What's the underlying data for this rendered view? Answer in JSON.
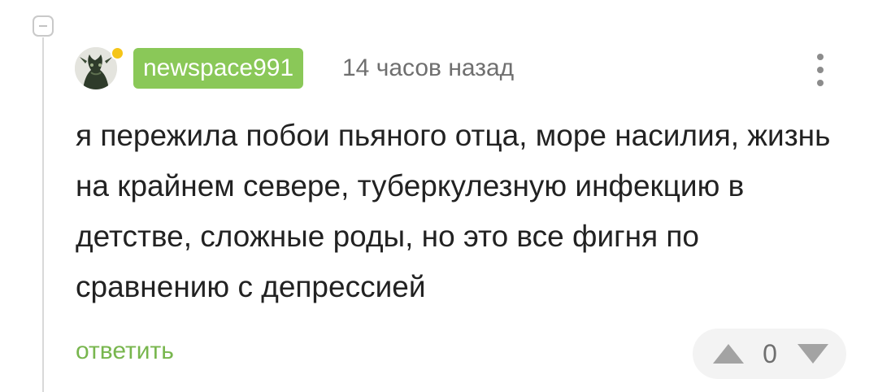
{
  "comment": {
    "author": {
      "username": "newspace991",
      "avatar_icon": "dragon-avatar-icon",
      "online": true
    },
    "time_ago": "14 часов назад",
    "text": "я пережила побои пьяного отца, море насилия, жизнь на крайнем севере, туберкулезную инфекцию в детстве, сложные роды, но это все фигня по сравнению с депрессией",
    "reply_label": "ответить",
    "rating": "0"
  },
  "icons": {
    "collapse": "collapse-minus-icon",
    "more": "more-vertical-icon",
    "upvote": "upvote-triangle-icon",
    "downvote": "downvote-triangle-icon"
  },
  "colors": {
    "username_bg": "#8ac858",
    "reply_link": "#78b64e",
    "online_dot": "#f5c518",
    "text": "#222222",
    "muted": "#6f6f6f"
  }
}
